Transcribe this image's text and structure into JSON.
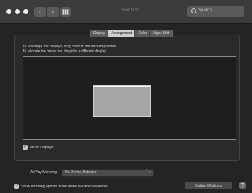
{
  "window": {
    "title": "Color LCD",
    "back_glyph": "‹",
    "forward_glyph": "›"
  },
  "search": {
    "placeholder": "Search"
  },
  "tabs": [
    {
      "label": "Display",
      "selected": false
    },
    {
      "label": "Arrangement",
      "selected": true
    },
    {
      "label": "Color",
      "selected": false
    },
    {
      "label": "Night Shift",
      "selected": false
    }
  ],
  "arrangement": {
    "instruction_line1": "To rearrange the displays, drag them to the desired position.",
    "instruction_line2": "To relocate the menu bar, drag it to a different display."
  },
  "mirror": {
    "label": "Mirror Displays",
    "checked": true,
    "check_glyph": "✓"
  },
  "airplay": {
    "label": "AirPlay Mirroring:",
    "value": "No Device Detected",
    "chevron": "⌃⌄"
  },
  "menubar_option": {
    "label": "Show mirroring options in the menu bar when available",
    "checked": true,
    "check_glyph": "✓"
  },
  "gather_button": {
    "label": "Gather Windows"
  },
  "help_button": {
    "label": "?"
  },
  "colors": {
    "background": "#242424",
    "titlebar": "#3b3b3b",
    "display_fill": "#a6a6a6"
  }
}
